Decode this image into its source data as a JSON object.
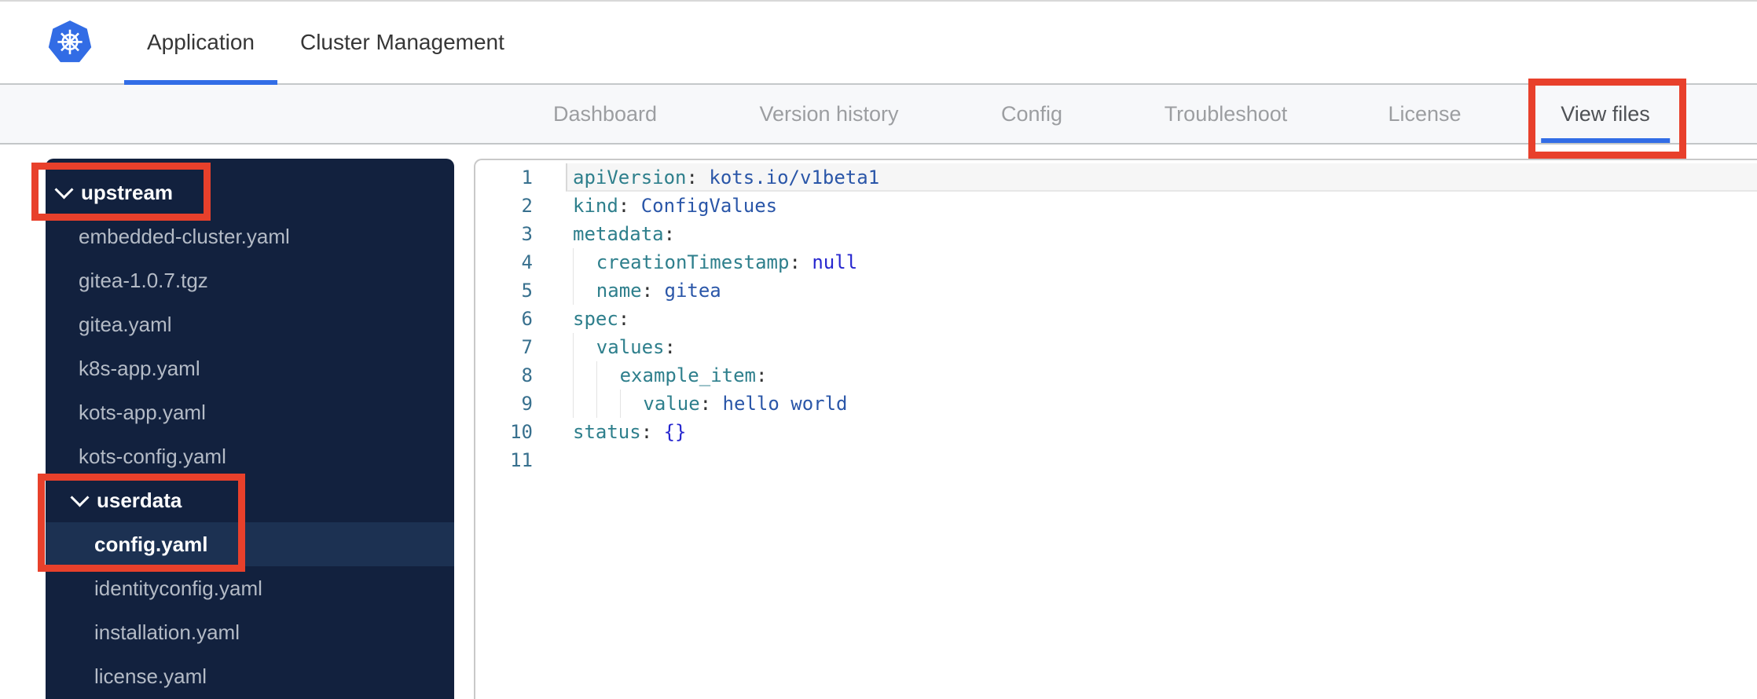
{
  "header": {
    "tabs": [
      {
        "label": "Application",
        "active": true
      },
      {
        "label": "Cluster Management",
        "active": false
      }
    ]
  },
  "subnav": {
    "items": [
      {
        "label": "Dashboard",
        "active": false
      },
      {
        "label": "Version history",
        "active": false
      },
      {
        "label": "Config",
        "active": false
      },
      {
        "label": "Troubleshoot",
        "active": false
      },
      {
        "label": "License",
        "active": false
      },
      {
        "label": "View files",
        "active": true
      }
    ]
  },
  "file_tree": {
    "items": [
      {
        "label": "upstream",
        "type": "folder",
        "level": 0,
        "expanded": true,
        "selected": false
      },
      {
        "label": "embedded-cluster.yaml",
        "type": "file",
        "level": 1,
        "selected": false
      },
      {
        "label": "gitea-1.0.7.tgz",
        "type": "file",
        "level": 1,
        "selected": false
      },
      {
        "label": "gitea.yaml",
        "type": "file",
        "level": 1,
        "selected": false
      },
      {
        "label": "k8s-app.yaml",
        "type": "file",
        "level": 1,
        "selected": false
      },
      {
        "label": "kots-app.yaml",
        "type": "file",
        "level": 1,
        "selected": false
      },
      {
        "label": "kots-config.yaml",
        "type": "file",
        "level": 1,
        "selected": false
      },
      {
        "label": "userdata",
        "type": "folder",
        "level": 1,
        "expanded": true,
        "selected": false
      },
      {
        "label": "config.yaml",
        "type": "file",
        "level": 2,
        "selected": true
      },
      {
        "label": "identityconfig.yaml",
        "type": "file",
        "level": 2,
        "selected": false
      },
      {
        "label": "installation.yaml",
        "type": "file",
        "level": 2,
        "selected": false
      },
      {
        "label": "license.yaml",
        "type": "file",
        "level": 2,
        "selected": false
      }
    ]
  },
  "editor": {
    "language": "yaml",
    "lines": [
      {
        "num": "1",
        "indent": 0,
        "current": true,
        "tokens": [
          [
            "k",
            "apiVersion"
          ],
          [
            "p",
            ": "
          ],
          [
            "v",
            "kots.io/v1beta1"
          ]
        ]
      },
      {
        "num": "2",
        "indent": 0,
        "current": false,
        "tokens": [
          [
            "k",
            "kind"
          ],
          [
            "p",
            ": "
          ],
          [
            "v",
            "ConfigValues"
          ]
        ]
      },
      {
        "num": "3",
        "indent": 0,
        "current": false,
        "tokens": [
          [
            "k",
            "metadata"
          ],
          [
            "p",
            ":"
          ]
        ]
      },
      {
        "num": "4",
        "indent": 1,
        "current": false,
        "tokens": [
          [
            "k",
            "creationTimestamp"
          ],
          [
            "p",
            ": "
          ],
          [
            "s",
            "null"
          ]
        ]
      },
      {
        "num": "5",
        "indent": 1,
        "current": false,
        "tokens": [
          [
            "k",
            "name"
          ],
          [
            "p",
            ": "
          ],
          [
            "v",
            "gitea"
          ]
        ]
      },
      {
        "num": "6",
        "indent": 0,
        "current": false,
        "tokens": [
          [
            "k",
            "spec"
          ],
          [
            "p",
            ":"
          ]
        ]
      },
      {
        "num": "7",
        "indent": 1,
        "current": false,
        "tokens": [
          [
            "k",
            "values"
          ],
          [
            "p",
            ":"
          ]
        ]
      },
      {
        "num": "8",
        "indent": 2,
        "current": false,
        "tokens": [
          [
            "k",
            "example_item"
          ],
          [
            "p",
            ":"
          ]
        ]
      },
      {
        "num": "9",
        "indent": 3,
        "current": false,
        "tokens": [
          [
            "k",
            "value"
          ],
          [
            "p",
            ": "
          ],
          [
            "v",
            "hello world"
          ]
        ]
      },
      {
        "num": "10",
        "indent": 0,
        "current": false,
        "tokens": [
          [
            "k",
            "status"
          ],
          [
            "p",
            ": "
          ],
          [
            "s",
            "{}"
          ]
        ]
      },
      {
        "num": "11",
        "indent": 0,
        "current": false,
        "tokens": []
      }
    ]
  },
  "annotations": [
    {
      "name": "view-files-highlight-box"
    },
    {
      "name": "upstream-highlight-box"
    },
    {
      "name": "userdata-config-highlight-box"
    }
  ],
  "icons": {
    "logo": "kubernetes-logo",
    "folder_chevron": "chevron-down-icon"
  },
  "colors": {
    "accent_blue": "#326de6",
    "kubernetes_blue": "#326ce5",
    "annotation_red": "#e8402b",
    "sidebar_bg": "#12213e",
    "sidebar_selected_bg": "#1c3152",
    "code_key": "#2e7f8c",
    "code_value": "#2a56a8",
    "code_special": "#2727cf",
    "line_number": "#38708e"
  }
}
